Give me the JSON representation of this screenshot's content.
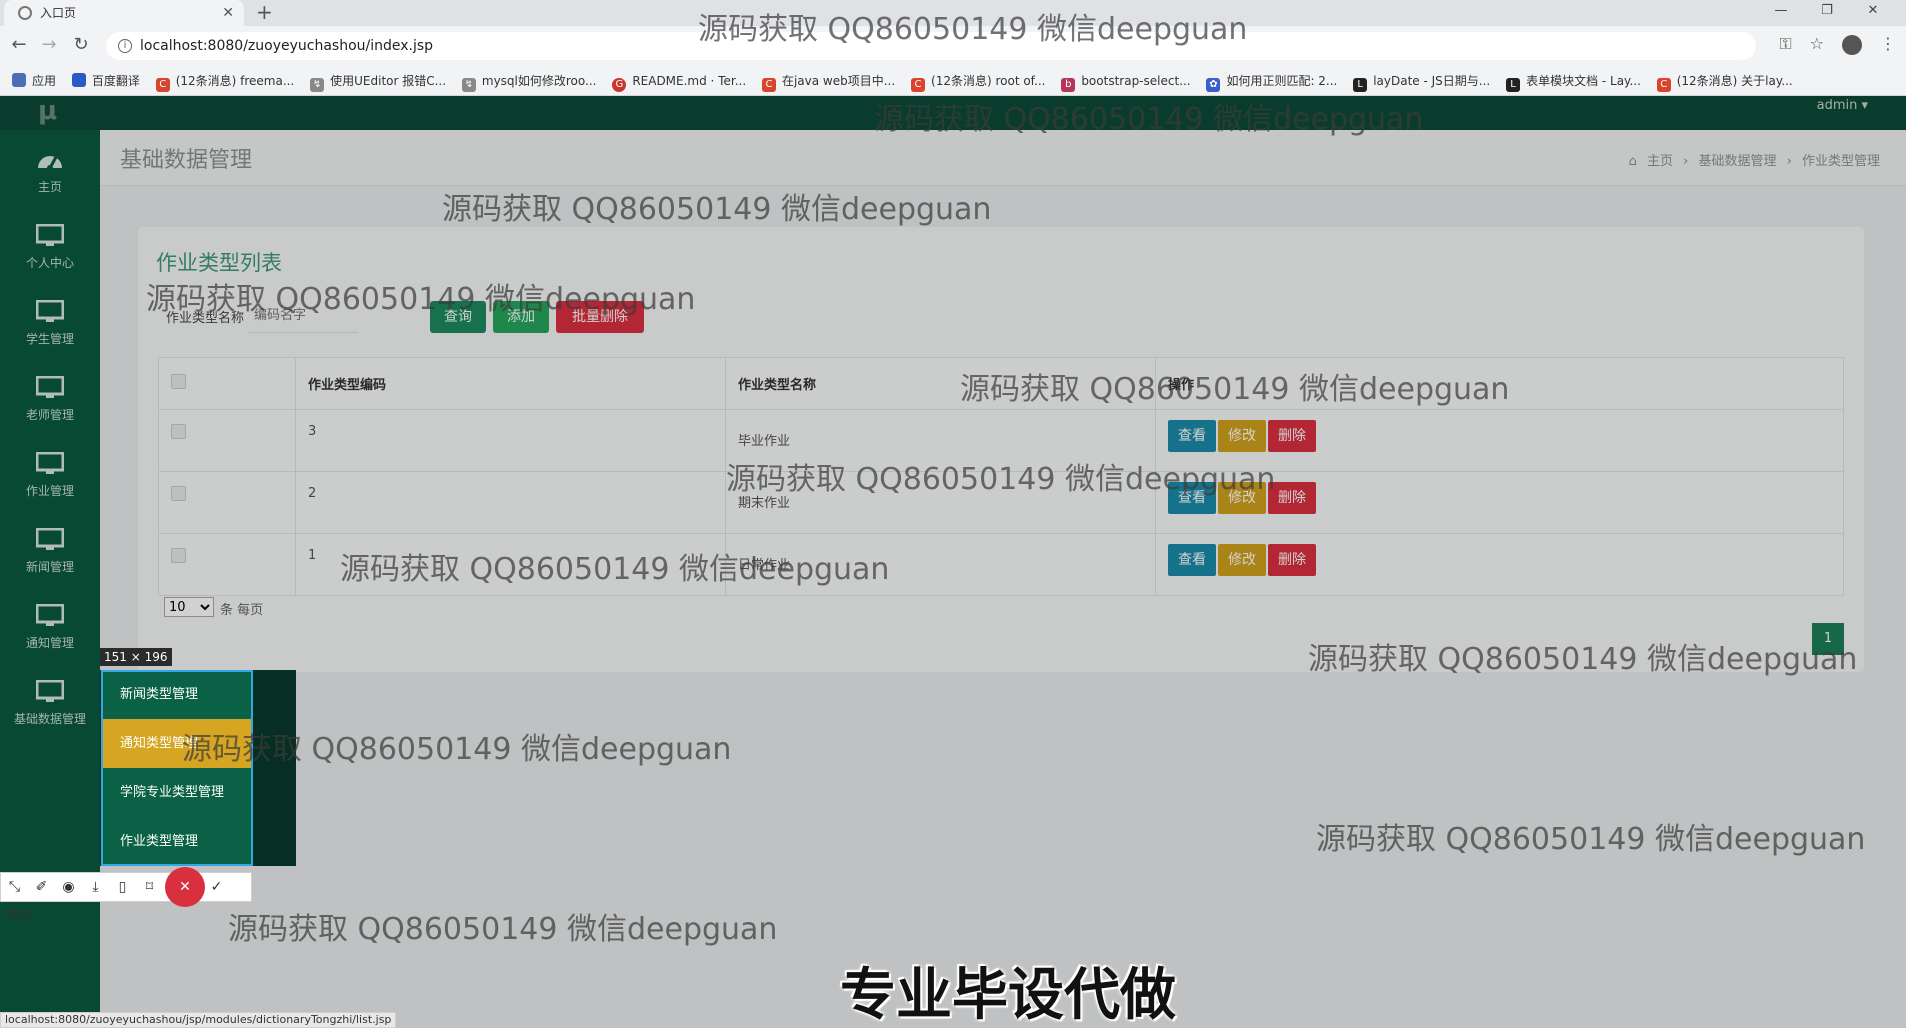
{
  "browser": {
    "tab_title": "入口页",
    "url": "localhost:8080/zuoyeyuchashou/index.jsp",
    "bookmarks": [
      {
        "label": "应用",
        "color": "#4a6fb5"
      },
      {
        "label": "百度翻译",
        "color": "#2a5ac8"
      },
      {
        "label": "(12条消息) freema...",
        "color": "#d9442c"
      },
      {
        "label": "使用UEditor 报错C...",
        "color": "#666666"
      },
      {
        "label": "mysql如何修改roo...",
        "color": "#666666"
      },
      {
        "label": "README.md · Ter...",
        "color": "#c7352b"
      },
      {
        "label": "在java web项目中...",
        "color": "#d9442c"
      },
      {
        "label": "(12条消息) root of...",
        "color": "#d9442c"
      },
      {
        "label": "bootstrap-select...",
        "color": "#b4365a"
      },
      {
        "label": "如何用正则匹配: 2...",
        "color": "#3a5fc9"
      },
      {
        "label": "layDate - JS日期与...",
        "color": "#222222"
      },
      {
        "label": "表单模块文档 - Lay...",
        "color": "#222222"
      },
      {
        "label": "(12条消息) 关于lay...",
        "color": "#d9442c"
      }
    ]
  },
  "app": {
    "logo": "μ",
    "admin_label": "admin ▾",
    "sidebar": [
      {
        "label": "主页",
        "icon": "dashboard-icon"
      },
      {
        "label": "个人中心",
        "icon": "monitor-icon"
      },
      {
        "label": "学生管理",
        "icon": "monitor-icon"
      },
      {
        "label": "老师管理",
        "icon": "monitor-icon"
      },
      {
        "label": "作业管理",
        "icon": "monitor-icon"
      },
      {
        "label": "新闻管理",
        "icon": "monitor-icon"
      },
      {
        "label": "通知管理",
        "icon": "monitor-icon"
      },
      {
        "label": "基础数据管理",
        "icon": "monitor-icon"
      }
    ],
    "page_title": "基础数据管理",
    "breadcrumb": [
      "主页",
      "基础数据管理",
      "作业类型管理"
    ],
    "panel_title": "作业类型列表",
    "search": {
      "label": "作业类型名称",
      "placeholder": "编码名字"
    },
    "buttons": {
      "query": "查询",
      "add": "添加",
      "batch_delete": "批量删除"
    },
    "table": {
      "headers": [
        "作业类型编码",
        "作业类型名称",
        "操作"
      ],
      "rows": [
        {
          "code": "3",
          "name": "毕业作业"
        },
        {
          "code": "2",
          "name": "期末作业"
        },
        {
          "code": "1",
          "name": "日常作业"
        }
      ],
      "actions": {
        "view": "查看",
        "edit": "修改",
        "delete": "删除"
      }
    },
    "pager": {
      "page_size": "10",
      "suffix": "条 每页",
      "current_page": "1"
    },
    "submenu": [
      "新闻类型管理",
      "通知类型管理",
      "学院专业类型管理",
      "作业类型管理"
    ]
  },
  "capture": {
    "size_label": "151 × 196",
    "done_label": "完成"
  },
  "status_url": "localhost:8080/zuoyeyuchashou/jsp/modules/dictionaryTongzhi/list.jsp",
  "watermark": "源码获取 QQ86050149 微信deepguan",
  "subtitle": "专业毕设代做"
}
